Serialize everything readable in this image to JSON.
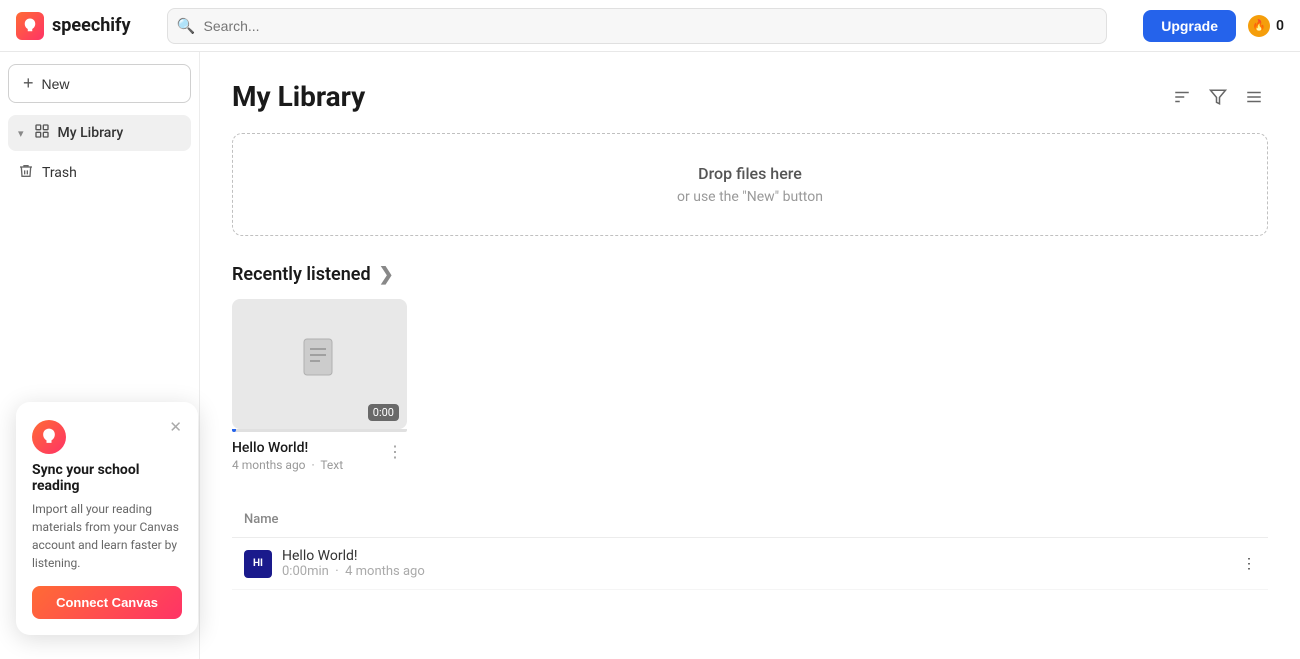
{
  "header": {
    "logo_name": "speechify",
    "search_placeholder": "Search...",
    "upgrade_label": "Upgrade",
    "coins_count": "0"
  },
  "sidebar": {
    "new_button_label": "New",
    "items": [
      {
        "id": "my-library",
        "label": "My Library",
        "icon": "📚",
        "active": true
      },
      {
        "id": "trash",
        "label": "Trash",
        "icon": "🗑️",
        "active": false
      }
    ]
  },
  "main": {
    "page_title": "My Library",
    "drop_zone": {
      "title": "Drop files here",
      "subtitle": "or use the \"New\" button"
    },
    "recently_listened": {
      "section_title": "Recently listened",
      "cards": [
        {
          "name": "Hello World!",
          "meta_time": "4 months ago",
          "meta_type": "Text",
          "time_badge": "0:00",
          "progress": 0
        }
      ]
    },
    "list": {
      "columns": [
        "Name"
      ],
      "rows": [
        {
          "icon_label": "HI",
          "name": "Hello World!",
          "duration": "0:00min",
          "date": "4 months ago"
        }
      ]
    }
  },
  "canvas_popup": {
    "title": "Sync your school reading",
    "description": "Import all your reading materials from your Canvas account and learn faster by listening.",
    "connect_label": "Connect Canvas"
  },
  "toolbar": {
    "sort_icon": "sort",
    "filter_icon": "filter",
    "view_icon": "view"
  }
}
